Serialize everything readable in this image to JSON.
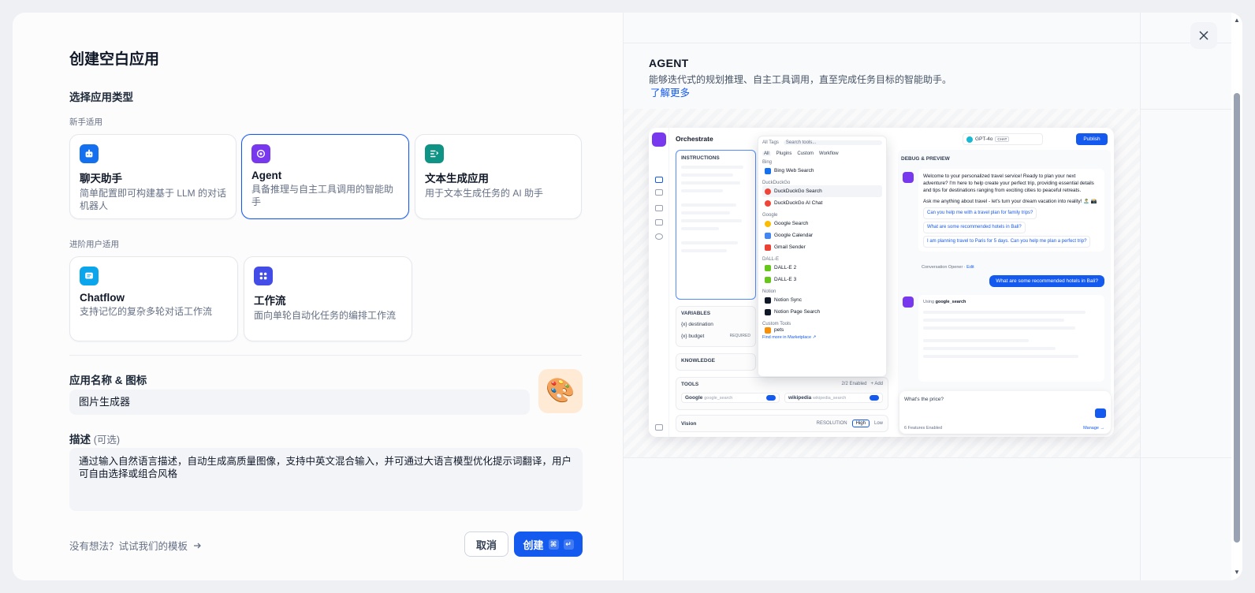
{
  "left": {
    "title": "创建空白应用",
    "select_type_label": "选择应用类型",
    "beginner_label": "新手适用",
    "advanced_label": "进阶用户适用",
    "beginner_cards": [
      {
        "name": "聊天助手",
        "desc": "简单配置即可构建基于 LLM 的对话机器人",
        "icon": "chat-bot-icon",
        "color": "#1570ef"
      },
      {
        "name": "Agent",
        "desc": "具备推理与自主工具调用的智能助手",
        "icon": "agent-icon",
        "color": "#7839ee"
      },
      {
        "name": "文本生成应用",
        "desc": "用于文本生成任务的 AI 助手",
        "icon": "text-generation-icon",
        "color": "#0e9384"
      }
    ],
    "advanced_cards": [
      {
        "name": "Chatflow",
        "desc": "支持记忆的复杂多轮对话工作流",
        "icon": "chatflow-icon",
        "color": "#0ba5ec"
      },
      {
        "name": "工作流",
        "desc": "面向单轮自动化任务的编排工作流",
        "icon": "workflow-icon",
        "color": "#444ce7"
      }
    ],
    "name_icon_label": "应用名称 & 图标",
    "app_name_value": "图片生成器",
    "app_icon_emoji": "🎨",
    "description_label": "描述",
    "description_optional": "(可选)",
    "description_value": "通过输入自然语言描述，自动生成高质量图像，支持中英文混合输入，并可通过大语言模型优化提示词翻译，用户可自由选择或组合风格",
    "template_link": "没有想法？试试我们的模板",
    "cancel_label": "取消",
    "create_label": "创建",
    "create_kbd_1": "⌘",
    "create_kbd_2": "↵"
  },
  "right": {
    "title": "AGENT",
    "desc": "能够迭代式的规划推理、自主工具调用，直至完成任务目标的智能助手。",
    "learn_more": "了解更多",
    "preview": {
      "header": "Orchestrate",
      "instructions": "INSTRUCTIONS",
      "variables": "VARIABLES",
      "var1": "{x} destination",
      "var2": "{x} budget",
      "required": "REQUIRED",
      "knowledge": "KNOWLEDGE",
      "tools": "TOOLS",
      "tools_enabled": "2/2 Enabled",
      "add": "+ Add",
      "tool1": "Google",
      "tool1_sub": "google_search",
      "tool2": "wikipedia",
      "tool2_sub": "wikipedia_search",
      "vision": "Vision",
      "resolution": "RESOLUTION",
      "high": "High",
      "low": "Low",
      "model": "GPT-4o",
      "chat_tag": "CHAT",
      "publish": "Publish",
      "debug": "DEBUG & PREVIEW",
      "dd_all_tags": "All Tags",
      "dd_search": "Search tools...",
      "dd_tabs": [
        "All",
        "Plugins",
        "Custom",
        "Workflow"
      ],
      "dd_groups": [
        {
          "group": "Bing",
          "items": [
            "Bing Web Search"
          ]
        },
        {
          "group": "DuckDuckGo",
          "items": [
            "DuckDuckGo Search",
            "DuckDuckGo AI Chat"
          ]
        },
        {
          "group": "Google",
          "items": [
            "Google Search",
            "Google Calendar",
            "Gmail Sender"
          ]
        },
        {
          "group": "DALL-E",
          "items": [
            "DALL-E 2",
            "DALL-E 3"
          ]
        },
        {
          "group": "Notion",
          "items": [
            "Notion Sync",
            "Notion Page Search"
          ]
        },
        {
          "group": "Custom Tools",
          "items": [
            "pets"
          ]
        }
      ],
      "dd_more": "Find more in",
      "dd_marketplace": "Marketplace ↗",
      "welcome": "Welcome to your personalized travel service! Ready to plan your next adventure? I'm here to help create your perfect trip, providing essential details and tips for destinations ranging from exciting cities to peaceful retreats.",
      "ask": "Ask me anything about travel - let's turn your dream vacation into reality! 🏝️ 📸",
      "sugg1": "Can you help me with a travel plan for family trips?",
      "sugg2": "What are some recommended hotels in Bali?",
      "sugg3": "I am planning travel to Paris for 5 days. Can you help me plan a perfect trip?",
      "opener": "Conversation Opener",
      "edit": "Edit",
      "user_msg": "What are some recommended hotels in Bali?",
      "using": "Using",
      "using_tool": "google_search",
      "input_text": "What's the price?",
      "features": "6 Features Enabled",
      "manage": "Manage →"
    }
  }
}
